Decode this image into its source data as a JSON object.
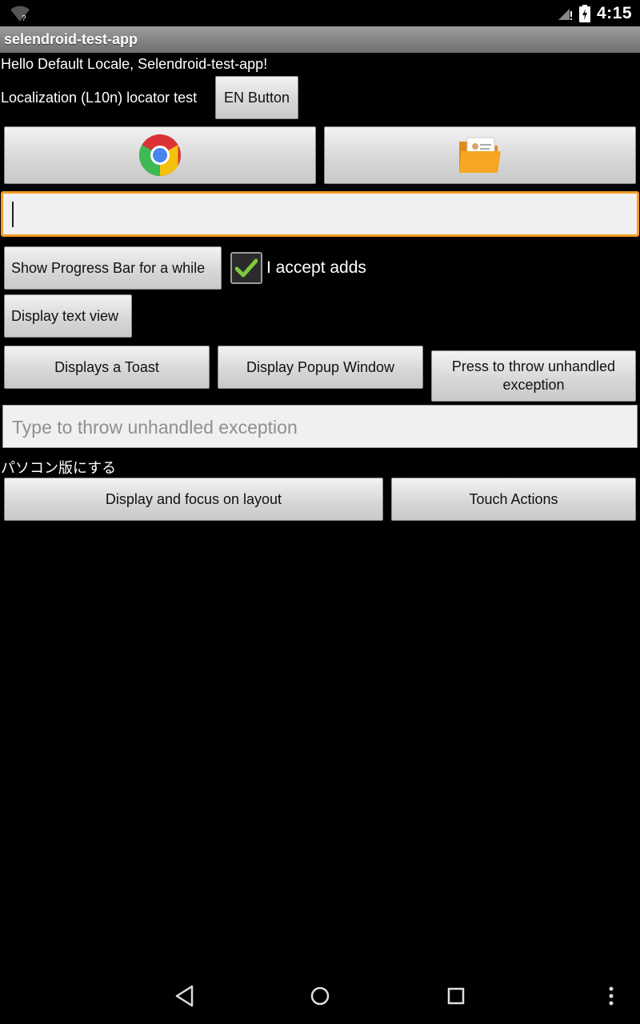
{
  "status_bar": {
    "time": "4:15"
  },
  "title_bar": {
    "title": "selendroid-test-app"
  },
  "hello_text": "Hello Default Locale, Selendroid-test-app!",
  "localization": {
    "label": "Localization (L10n) locator test",
    "button": "EN Button"
  },
  "icon_buttons": [
    {
      "icon": "chrome-icon"
    },
    {
      "icon": "contacts-folder-icon"
    }
  ],
  "text_field": {
    "value": ""
  },
  "progress_button": "Show Progress Bar for a while",
  "checkbox": {
    "label": "I accept adds",
    "checked": true
  },
  "text_view_button": "Display text view",
  "toast_button": "Displays a Toast",
  "popup_button": "Display Popup Window",
  "exception_button": "Press to throw unhandled exception",
  "exception_field": {
    "placeholder": "Type to throw unhandled exception"
  },
  "japanese_text": "パソコン版にする",
  "layout_button": "Display and focus on layout",
  "touch_button": "Touch Actions",
  "colors": {
    "focus_border": "#f39a26",
    "check": "#7ec93f"
  }
}
